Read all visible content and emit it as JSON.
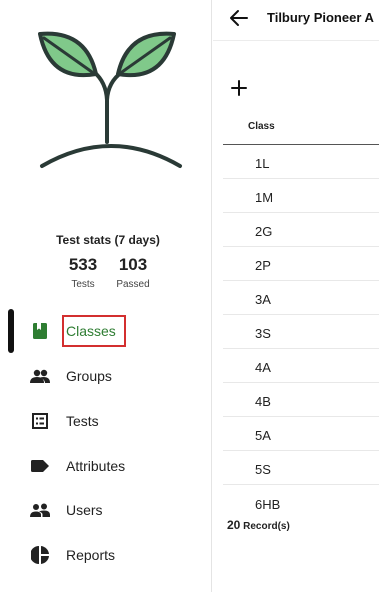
{
  "stats": {
    "title": "Test stats (7 days)",
    "tests_value": "533",
    "tests_label": "Tests",
    "passed_value": "103",
    "passed_label": "Passed"
  },
  "nav": {
    "items": [
      {
        "label": "Classes",
        "icon": "book-icon",
        "active": true
      },
      {
        "label": "Groups",
        "icon": "people-icon"
      },
      {
        "label": "Tests",
        "icon": "list-icon"
      },
      {
        "label": "Attributes",
        "icon": "label-icon"
      },
      {
        "label": "Users",
        "icon": "users-icon"
      },
      {
        "label": "Reports",
        "icon": "pie-chart-icon"
      }
    ]
  },
  "header": {
    "title": "Tilbury Pioneer A"
  },
  "table": {
    "column_header": "Class",
    "rows": [
      "1L",
      "1M",
      "2G",
      "2P",
      "3A",
      "3S",
      "4A",
      "4B",
      "5A",
      "5S",
      "6HB"
    ]
  },
  "footer": {
    "record_count": "20",
    "record_label": "Record(s)"
  },
  "colors": {
    "accent": "#2e7d32",
    "leaf": "#80c98a",
    "highlight": "#d32f2f"
  }
}
